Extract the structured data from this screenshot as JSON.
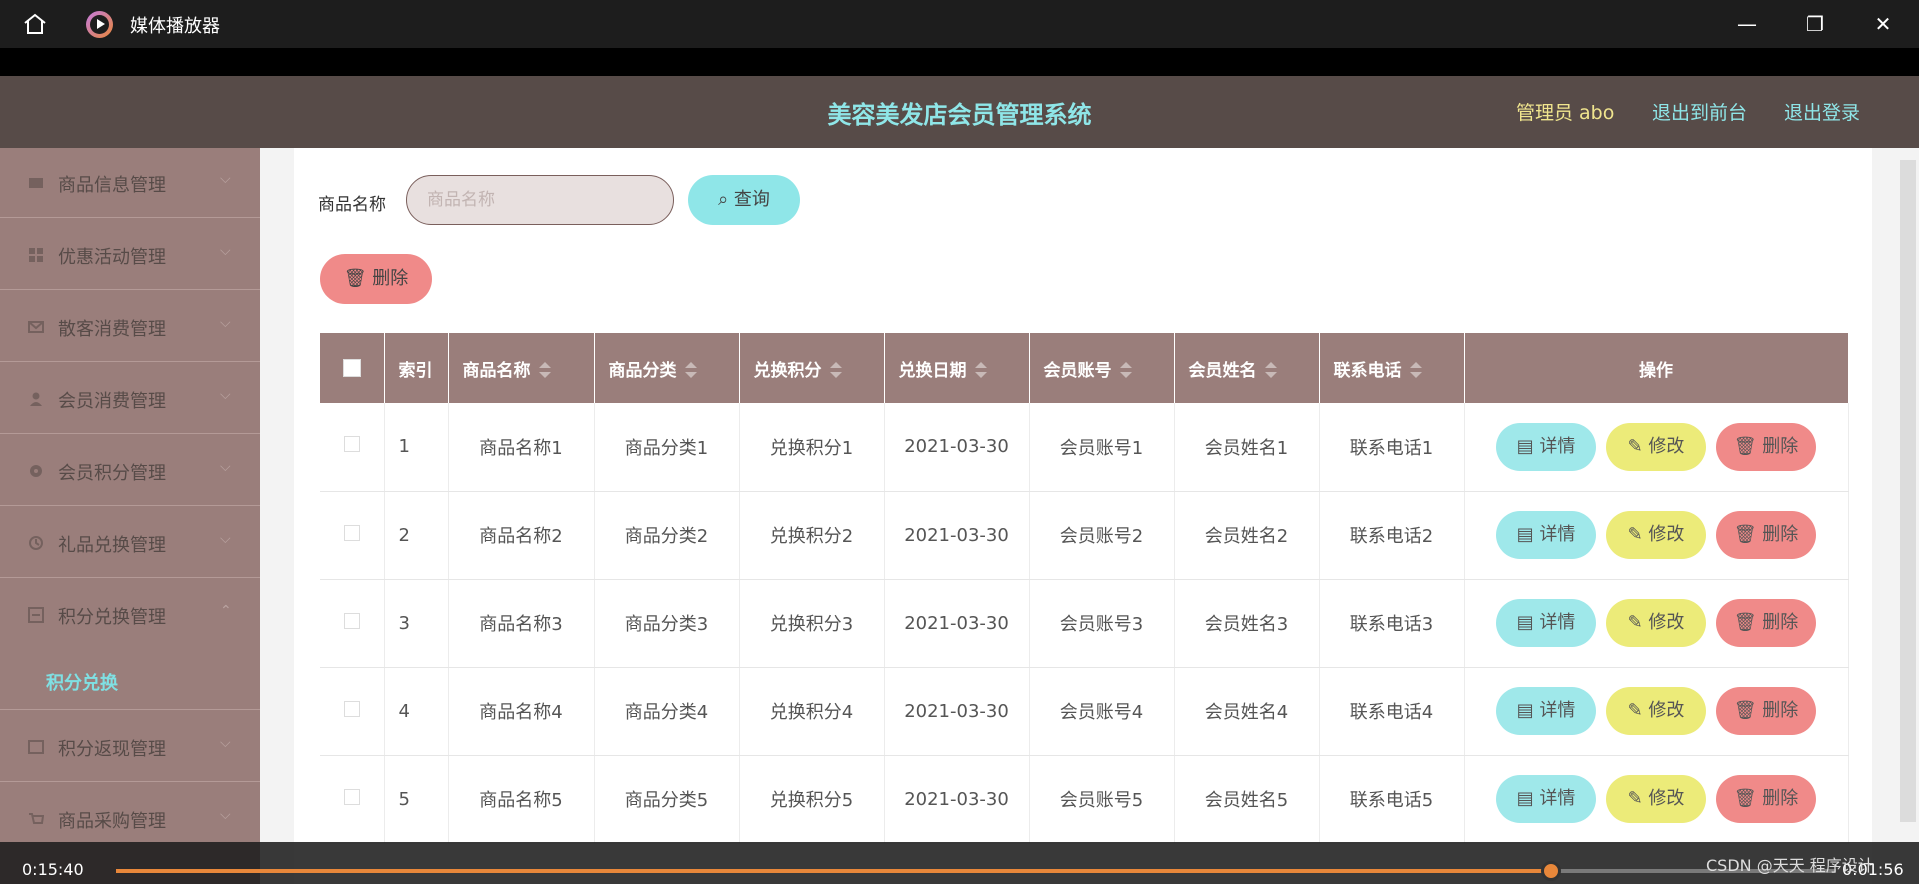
{
  "window": {
    "app_title": "媒体播放器",
    "icons": [
      "home-icon",
      "media-player-icon",
      "minimize-icon",
      "restore-icon",
      "close-icon"
    ]
  },
  "topnav": {
    "title": "美容美发店会员管理系统",
    "admin": "管理员 abo",
    "to_front": "退出到前台",
    "logout": "退出登录",
    "colors": {
      "bar": "#574b48",
      "title": "#8fe6e8",
      "admin": "#f0e58e"
    }
  },
  "sidebar": {
    "items": [
      {
        "label": "商品信息管理",
        "icon": "product-icon"
      },
      {
        "label": "优惠活动管理",
        "icon": "grid-icon"
      },
      {
        "label": "散客消费管理",
        "icon": "mail-icon"
      },
      {
        "label": "会员消费管理",
        "icon": "user-icon"
      },
      {
        "label": "会员积分管理",
        "icon": "gear-icon"
      },
      {
        "label": "礼品兑换管理",
        "icon": "gift-icon"
      },
      {
        "label": "积分兑换管理",
        "icon": "exchange-icon"
      },
      {
        "label": "积分返现管理",
        "icon": "card-icon"
      },
      {
        "label": "商品采购管理",
        "icon": "cart-icon"
      }
    ],
    "active_sub": "积分兑换"
  },
  "search": {
    "label": "商品名称",
    "placeholder": "商品名称",
    "query_label": "查询",
    "delete_label": "删除"
  },
  "table": {
    "columns": [
      "索引",
      "商品名称",
      "商品分类",
      "兑换积分",
      "兑换日期",
      "会员账号",
      "会员姓名",
      "联系电话",
      "操作"
    ],
    "rows": [
      {
        "idx": "1",
        "name": "商品名称1",
        "category": "商品分类1",
        "points": "兑换积分1",
        "date": "2021-03-30",
        "account": "会员账号1",
        "member": "会员姓名1",
        "phone": "联系电话1"
      },
      {
        "idx": "2",
        "name": "商品名称2",
        "category": "商品分类2",
        "points": "兑换积分2",
        "date": "2021-03-30",
        "account": "会员账号2",
        "member": "会员姓名2",
        "phone": "联系电话2"
      },
      {
        "idx": "3",
        "name": "商品名称3",
        "category": "商品分类3",
        "points": "兑换积分3",
        "date": "2021-03-30",
        "account": "会员账号3",
        "member": "会员姓名3",
        "phone": "联系电话3"
      },
      {
        "idx": "4",
        "name": "商品名称4",
        "category": "商品分类4",
        "points": "兑换积分4",
        "date": "2021-03-30",
        "account": "会员账号4",
        "member": "会员姓名4",
        "phone": "联系电话4"
      },
      {
        "idx": "5",
        "name": "商品名称5",
        "category": "商品分类5",
        "points": "兑换积分5",
        "date": "2021-03-30",
        "account": "会员账号5",
        "member": "会员姓名5",
        "phone": "联系电话5"
      }
    ],
    "actions": {
      "detail": "详情",
      "edit": "修改",
      "remove": "删除"
    }
  },
  "player": {
    "current_time": "0:15:40",
    "remaining_time": "0:01:56",
    "progress": 0.836
  },
  "watermark": "CSDN @天天 程序设计"
}
